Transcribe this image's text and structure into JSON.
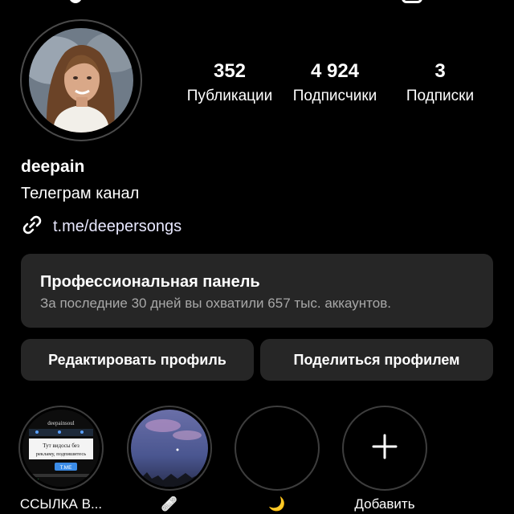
{
  "profile": {
    "username": "deepain",
    "bio": "Телеграм канал",
    "link": "t.me/deepersongs",
    "stats": [
      {
        "value": "352",
        "label": "Публикации"
      },
      {
        "value": "4 924",
        "label": "Подписчики"
      },
      {
        "value": "3",
        "label": "Подписки"
      }
    ]
  },
  "pro_panel": {
    "title": "Профессиональная панель",
    "subtitle": "За последние 30 дней вы охватили 657 тыс. аккаунтов."
  },
  "buttons": {
    "edit": "Редактировать профиль",
    "share": "Поделиться профилем"
  },
  "highlights": [
    {
      "label": "ССЫЛКА В...",
      "preview": {
        "channel": "deepainsoul",
        "line1": "Тут видосы без",
        "line2": "рекламу, подпишитесь",
        "tme": "T.ME"
      }
    },
    {
      "label": "🩹"
    },
    {
      "label": "🌙"
    },
    {
      "label": "Добавить"
    }
  ],
  "colors": {
    "background": "#000000",
    "panel": "#262626",
    "secondary_text": "#a8a8a8",
    "ring": "#3d3d3d"
  },
  "icons": [
    "link-icon",
    "plus-icon"
  ]
}
